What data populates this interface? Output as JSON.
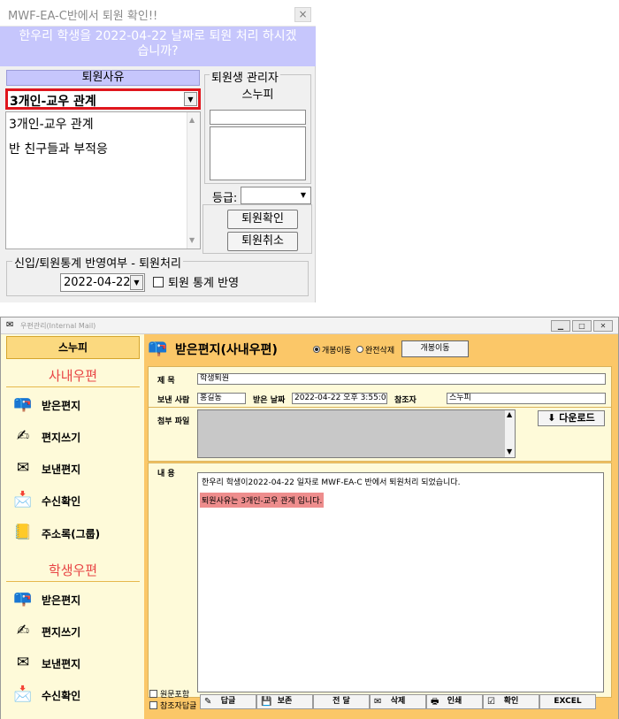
{
  "dialog": {
    "title": "MWF-EA-C반에서 퇴원 확인!!",
    "close_glyph": "×",
    "banner_line1": "한우리 학생을 2022-04-22 날짜로 퇴원 처리 하시겠",
    "banner_line2": "습니까?",
    "reason_header": "퇴원사유",
    "reason_selected": "3개인-교우 관계",
    "reason_options": [
      "3개인-교우 관계",
      "반 친구들과 부적응"
    ],
    "manager_legend": "퇴원생 관리자",
    "manager_name": "스누피",
    "grade_label": "등급:",
    "confirm_button": "퇴원확인",
    "cancel_button": "퇴원취소",
    "stats_legend": "신입/퇴원통계 반영여부 - 퇴원처리",
    "stats_date": "2022-04-22",
    "stats_checkbox_label": "퇴원 통계 반영"
  },
  "mail": {
    "window_title": "우편관리(Internal Mail)",
    "user_name": "스누피",
    "company_section": "사내우편",
    "company_items": [
      {
        "label": "받은편지",
        "icon": "mailbox-icon"
      },
      {
        "label": "편지쓰기",
        "icon": "compose-icon"
      },
      {
        "label": "보낸편지",
        "icon": "sent-icon"
      },
      {
        "label": "수신확인",
        "icon": "receipt-icon"
      },
      {
        "label": "주소록(그룹)",
        "icon": "addressbook-icon"
      }
    ],
    "student_section": "학생우편",
    "student_items": [
      {
        "label": "받은편지",
        "icon": "mailbox-icon"
      },
      {
        "label": "편지쓰기",
        "icon": "compose-icon"
      },
      {
        "label": "보낸편지",
        "icon": "sent-icon"
      },
      {
        "label": "수신확인",
        "icon": "receipt-icon"
      }
    ],
    "folder_title": "받은편지(사내우편)",
    "radio_move": "개봉이동",
    "radio_delete": "완전삭제",
    "move_button": "개봉이동",
    "subject_label": "제    목",
    "subject_value": "학생퇴원",
    "sender_label": "보낸 사람",
    "sender_value": "홍길동",
    "received_label": "받은 날짜",
    "received_value": "2022-04-22 오후 3:55:00",
    "cc_label": "참조자",
    "cc_value": "스누피",
    "attach_label": "첨부 파일",
    "download_button": "다운로드",
    "body_label": "내    용",
    "body_line1": "한우리  학생이2022-04-22 일자로 MWF-EA-C 반에서 퇴원처리 되었습니다.",
    "body_line2": "퇴원사유는 3개인-교우 관계 입니다.",
    "check_original": "원문포함",
    "check_cc_reply": "참조자답글",
    "toolbar": {
      "reply": "답글",
      "save": "보존",
      "forward": "전 달",
      "delete": "삭제",
      "print": "인쇄",
      "confirm": "확인",
      "excel": "EXCEL"
    }
  }
}
